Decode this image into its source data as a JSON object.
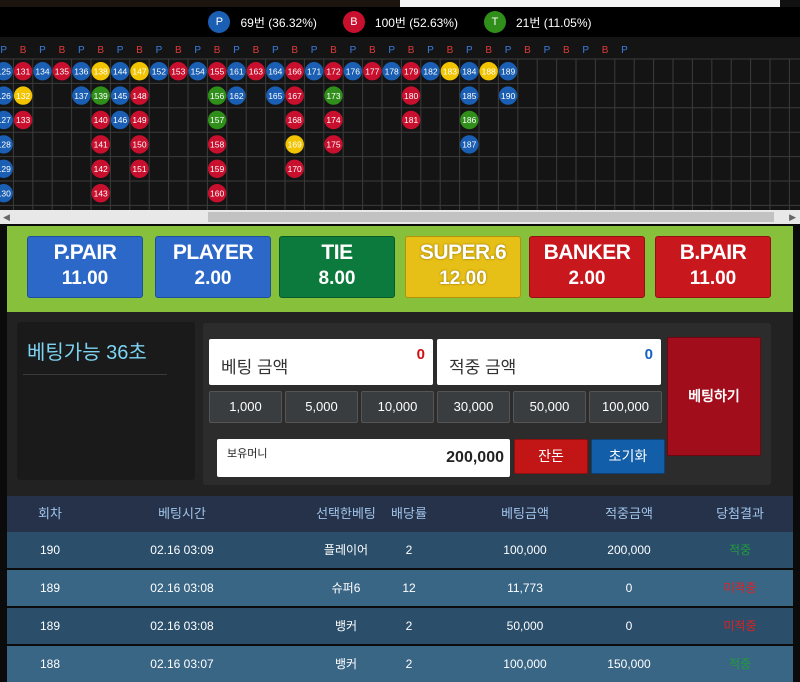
{
  "stats": {
    "player": {
      "icon": "P",
      "label": "69번 (36.32%)"
    },
    "banker": {
      "icon": "B",
      "label": "100번 (52.63%)"
    },
    "tie": {
      "icon": "T",
      "label": "21번 (11.05%)"
    }
  },
  "colors": {
    "player": "#1a5fb4",
    "banker": "#c8102e",
    "tie": "#2f8f1a",
    "super6": "#f2c400"
  },
  "road": {
    "header": [
      "P",
      "B",
      "P",
      "B",
      "P",
      "B",
      "P",
      "B",
      "P",
      "B",
      "P",
      "B",
      "P",
      "B",
      "P",
      "B",
      "P",
      "B",
      "P",
      "B",
      "P",
      "B",
      "P",
      "B",
      "P",
      "B",
      "P",
      "B",
      "P",
      "B",
      "P",
      "B",
      "P"
    ],
    "columns": [
      [
        {
          "n": "125",
          "c": "P"
        },
        {
          "n": "126",
          "c": "P"
        },
        {
          "n": "127",
          "c": "P"
        },
        {
          "n": "128",
          "c": "P"
        },
        {
          "n": "129",
          "c": "P"
        },
        {
          "n": "130",
          "c": "P"
        }
      ],
      [
        {
          "n": "131",
          "c": "B"
        },
        {
          "n": "132",
          "c": "S"
        },
        {
          "n": "133",
          "c": "B"
        }
      ],
      [
        {
          "n": "134",
          "c": "P"
        }
      ],
      [
        {
          "n": "135",
          "c": "B"
        }
      ],
      [
        {
          "n": "136",
          "c": "P"
        },
        {
          "n": "137",
          "c": "P"
        }
      ],
      [
        {
          "n": "138",
          "c": "S"
        },
        {
          "n": "139",
          "c": "T"
        },
        {
          "n": "140",
          "c": "B"
        },
        {
          "n": "141",
          "c": "B"
        },
        {
          "n": "142",
          "c": "B"
        },
        {
          "n": "143",
          "c": "B"
        }
      ],
      [
        {
          "n": "144",
          "c": "P"
        },
        {
          "n": "145",
          "c": "P"
        },
        {
          "n": "146",
          "c": "P"
        }
      ],
      [
        {
          "n": "147",
          "c": "S"
        },
        {
          "n": "148",
          "c": "B"
        },
        {
          "n": "149",
          "c": "B"
        },
        {
          "n": "150",
          "c": "B"
        },
        {
          "n": "151",
          "c": "B"
        }
      ],
      [
        {
          "n": "152",
          "c": "P"
        }
      ],
      [
        {
          "n": "153",
          "c": "B"
        }
      ],
      [
        {
          "n": "154",
          "c": "P"
        }
      ],
      [
        {
          "n": "155",
          "c": "B"
        },
        {
          "n": "156",
          "c": "T"
        },
        {
          "n": "157",
          "c": "T"
        },
        {
          "n": "158",
          "c": "B"
        },
        {
          "n": "159",
          "c": "B"
        },
        {
          "n": "160",
          "c": "B"
        }
      ],
      [
        {
          "n": "161",
          "c": "P"
        },
        {
          "n": "162",
          "c": "P"
        }
      ],
      [
        {
          "n": "163",
          "c": "B"
        }
      ],
      [
        {
          "n": "164",
          "c": "P"
        },
        {
          "n": "165",
          "c": "P"
        }
      ],
      [
        {
          "n": "166",
          "c": "B"
        },
        {
          "n": "167",
          "c": "B"
        },
        {
          "n": "168",
          "c": "B"
        },
        {
          "n": "169",
          "c": "S"
        },
        {
          "n": "170",
          "c": "B"
        }
      ],
      [
        {
          "n": "171",
          "c": "P"
        }
      ],
      [
        {
          "n": "172",
          "c": "B"
        },
        {
          "n": "173",
          "c": "T"
        },
        {
          "n": "174",
          "c": "B"
        },
        {
          "n": "175",
          "c": "B"
        }
      ],
      [
        {
          "n": "176",
          "c": "P"
        }
      ],
      [
        {
          "n": "177",
          "c": "B"
        }
      ],
      [
        {
          "n": "178",
          "c": "P"
        }
      ],
      [
        {
          "n": "179",
          "c": "B"
        },
        {
          "n": "180",
          "c": "B"
        },
        {
          "n": "181",
          "c": "B"
        }
      ],
      [
        {
          "n": "182",
          "c": "P"
        }
      ],
      [
        {
          "n": "183",
          "c": "S"
        }
      ],
      [
        {
          "n": "184",
          "c": "P"
        },
        {
          "n": "185",
          "c": "P"
        },
        {
          "n": "186",
          "c": "T"
        },
        {
          "n": "187",
          "c": "P"
        }
      ],
      [
        {
          "n": "188",
          "c": "S"
        }
      ],
      [
        {
          "n": "189",
          "c": "P"
        },
        {
          "n": "190",
          "c": "P"
        }
      ]
    ]
  },
  "bets": [
    {
      "name": "P.PAIR",
      "odds": "11.00",
      "color": "blue"
    },
    {
      "name": "PLAYER",
      "odds": "2.00",
      "color": "blue"
    },
    {
      "name": "TIE",
      "odds": "8.00",
      "color": "green"
    },
    {
      "name": "SUPER.6",
      "odds": "12.00",
      "color": "yellow"
    },
    {
      "name": "BANKER",
      "odds": "2.00",
      "color": "red"
    },
    {
      "name": "B.PAIR",
      "odds": "11.00",
      "color": "red"
    }
  ],
  "betting": {
    "timer_label": "베팅가능 36초",
    "bet_amount_label": "베팅 금액",
    "bet_amount_value": "0",
    "win_amount_label": "적중 금액",
    "win_amount_value": "0",
    "chips": [
      "1,000",
      "5,000",
      "10,000",
      "30,000",
      "50,000",
      "100,000"
    ],
    "wallet_label": "보유머니",
    "wallet_value": "200,000",
    "change_label": "잔돈",
    "reset_label": "초기화",
    "submit_label": "베팅하기"
  },
  "history": {
    "headers": [
      "회차",
      "베팅시간",
      "선택한베팅",
      "배당률",
      "베팅금액",
      "적중금액",
      "당첨결과"
    ],
    "rows": [
      {
        "round": "190",
        "time": "02.16 03:09",
        "pick": "플레이어",
        "odds": "2",
        "amount": "100,000",
        "payout": "200,000",
        "result": "적중",
        "status": "win"
      },
      {
        "round": "189",
        "time": "02.16 03:08",
        "pick": "슈퍼6",
        "odds": "12",
        "amount": "11,773",
        "payout": "0",
        "result": "미적중",
        "status": "lose"
      },
      {
        "round": "189",
        "time": "02.16 03:08",
        "pick": "뱅커",
        "odds": "2",
        "amount": "50,000",
        "payout": "0",
        "result": "미적중",
        "status": "lose"
      },
      {
        "round": "188",
        "time": "02.16 03:07",
        "pick": "뱅커",
        "odds": "2",
        "amount": "100,000",
        "payout": "150,000",
        "result": "적중",
        "status": "win"
      }
    ]
  }
}
